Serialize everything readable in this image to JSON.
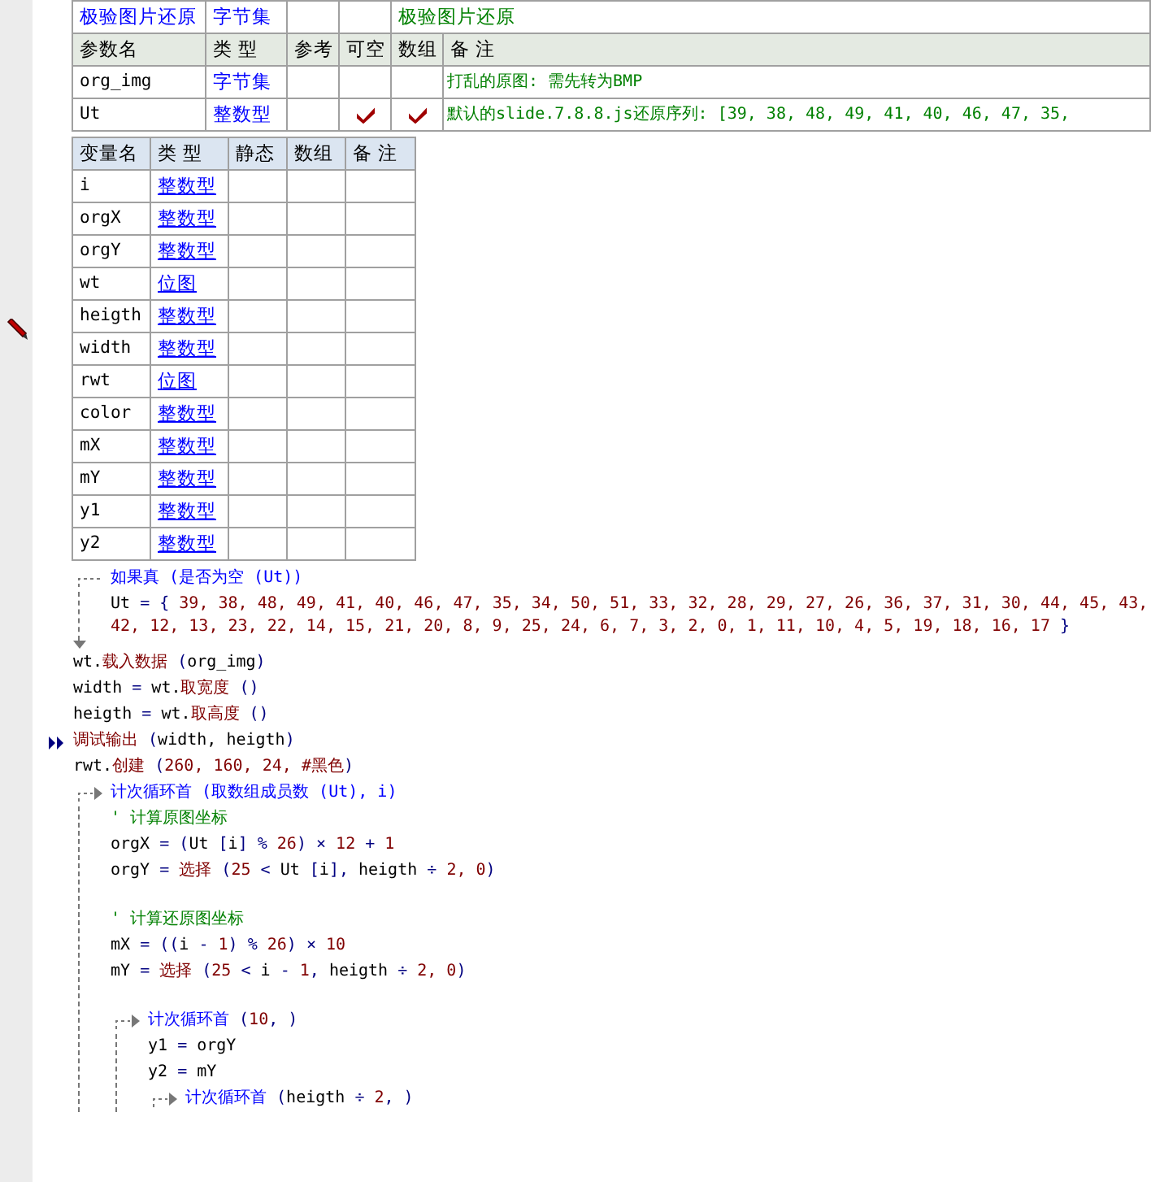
{
  "subroutine": {
    "name": "极验图片还原",
    "return_type": "字节集",
    "remark": "极验图片还原"
  },
  "params": {
    "columns": [
      "参数名",
      "类 型",
      "参考",
      "可空",
      "数组",
      "备 注"
    ],
    "rows": [
      {
        "name": "org_img",
        "type": "字节集",
        "ref": false,
        "nullable": false,
        "array": false,
        "remark": "打乱的原图: 需先转为BMP"
      },
      {
        "name": "Ut",
        "type": "整数型",
        "ref": false,
        "nullable": true,
        "array": true,
        "remark": "默认的slide.7.8.8.js还原序列: [39, 38, 48, 49, 41, 40, 46, 47, 35,"
      }
    ]
  },
  "variables": {
    "columns": [
      "变量名",
      "类 型",
      "静态",
      "数组",
      "备 注"
    ],
    "rows": [
      {
        "name": "i",
        "type": "整数型",
        "static": false,
        "array": false
      },
      {
        "name": "orgX",
        "type": "整数型",
        "static": false,
        "array": false
      },
      {
        "name": "orgY",
        "type": "整数型",
        "static": false,
        "array": false
      },
      {
        "name": "wt",
        "type": "位图",
        "static": false,
        "array": false
      },
      {
        "name": "heigth",
        "type": "整数型",
        "static": false,
        "array": false
      },
      {
        "name": "width",
        "type": "整数型",
        "static": false,
        "array": false
      },
      {
        "name": "rwt",
        "type": "位图",
        "static": false,
        "array": false
      },
      {
        "name": "color",
        "type": "整数型",
        "static": false,
        "array": false
      },
      {
        "name": "mX",
        "type": "整数型",
        "static": false,
        "array": false
      },
      {
        "name": "mY",
        "type": "整数型",
        "static": false,
        "array": false
      },
      {
        "name": "y1",
        "type": "整数型",
        "static": false,
        "array": false
      },
      {
        "name": "y2",
        "type": "整数型",
        "static": false,
        "array": false
      }
    ]
  },
  "code": [
    {
      "kind": "if",
      "head": [
        {
          "kind": "kw",
          "text": "如果真 (是否为空 (Ut))"
        }
      ],
      "children": [
        {
          "kind": "code",
          "segments": [
            {
              "kind": "var",
              "text": "Ut"
            },
            {
              "kind": "op",
              "text": " = { "
            },
            {
              "kind": "num",
              "text": "39, 38, 48, 49, 41, 40, 46, 47, 35, 34, 50, 51, 33, 32, 28, 29, 27, 26, 36, 37, 31, 30, 44, 45, 43, 42, 12, 13, 23, 22, 14, 15, 21, 20, 8, 9, 25, 24, 6, 7, 3, 2, 0, 1, 11, 10, 4, 5, 19, 18, 16, 17"
            },
            {
              "kind": "op",
              "text": " }"
            }
          ]
        }
      ]
    },
    {
      "kind": "code",
      "segments": [
        {
          "kind": "var",
          "text": "wt."
        },
        {
          "kind": "fn",
          "text": "载入数据"
        },
        {
          "kind": "op",
          "text": " ("
        },
        {
          "kind": "var",
          "text": "org_img"
        },
        {
          "kind": "op",
          "text": ")"
        }
      ]
    },
    {
      "kind": "code",
      "segments": [
        {
          "kind": "var",
          "text": "width"
        },
        {
          "kind": "op",
          "text": " = "
        },
        {
          "kind": "var",
          "text": "wt."
        },
        {
          "kind": "fn",
          "text": "取宽度"
        },
        {
          "kind": "op",
          "text": " ()"
        }
      ]
    },
    {
      "kind": "code",
      "segments": [
        {
          "kind": "var",
          "text": "heigth"
        },
        {
          "kind": "op",
          "text": " = "
        },
        {
          "kind": "var",
          "text": "wt."
        },
        {
          "kind": "fn",
          "text": "取高度"
        },
        {
          "kind": "op",
          "text": " ()"
        }
      ]
    },
    {
      "kind": "debug",
      "segments": [
        {
          "kind": "fn",
          "text": "调试输出"
        },
        {
          "kind": "op",
          "text": " ("
        },
        {
          "kind": "var",
          "text": "width, heigth"
        },
        {
          "kind": "op",
          "text": ")"
        }
      ]
    },
    {
      "kind": "code",
      "segments": [
        {
          "kind": "var",
          "text": "rwt."
        },
        {
          "kind": "fn",
          "text": "创建"
        },
        {
          "kind": "op",
          "text": " ("
        },
        {
          "kind": "num",
          "text": "260, 160, 24, "
        },
        {
          "kind": "fn",
          "text": "#黑色"
        },
        {
          "kind": "op",
          "text": ")"
        }
      ]
    },
    {
      "kind": "loop",
      "head": [
        {
          "kind": "kw",
          "text": "计次循环首 (取数组成员数 (Ut), i)"
        }
      ],
      "children": [
        {
          "kind": "comment",
          "text": "' 计算原图坐标"
        },
        {
          "kind": "code",
          "segments": [
            {
              "kind": "var",
              "text": "orgX"
            },
            {
              "kind": "op",
              "text": " = ("
            },
            {
              "kind": "var",
              "text": "Ut"
            },
            {
              "kind": "op",
              "text": " ["
            },
            {
              "kind": "var",
              "text": "i"
            },
            {
              "kind": "op",
              "text": "] % "
            },
            {
              "kind": "num",
              "text": "26"
            },
            {
              "kind": "op",
              "text": ") × "
            },
            {
              "kind": "num",
              "text": "12"
            },
            {
              "kind": "op",
              "text": " + "
            },
            {
              "kind": "num",
              "text": "1"
            }
          ]
        },
        {
          "kind": "code",
          "segments": [
            {
              "kind": "var",
              "text": "orgY"
            },
            {
              "kind": "op",
              "text": " = "
            },
            {
              "kind": "fn",
              "text": "选择"
            },
            {
              "kind": "op",
              "text": " ("
            },
            {
              "kind": "num",
              "text": "25"
            },
            {
              "kind": "op",
              "text": " < "
            },
            {
              "kind": "var",
              "text": "Ut"
            },
            {
              "kind": "op",
              "text": " ["
            },
            {
              "kind": "var",
              "text": "i"
            },
            {
              "kind": "op",
              "text": "], "
            },
            {
              "kind": "var",
              "text": "heigth"
            },
            {
              "kind": "op",
              "text": " ÷ "
            },
            {
              "kind": "num",
              "text": "2, 0"
            },
            {
              "kind": "op",
              "text": ")"
            }
          ]
        },
        {
          "kind": "blank"
        },
        {
          "kind": "comment",
          "text": "' 计算还原图坐标"
        },
        {
          "kind": "code",
          "segments": [
            {
              "kind": "var",
              "text": "mX"
            },
            {
              "kind": "op",
              "text": " = (("
            },
            {
              "kind": "var",
              "text": "i"
            },
            {
              "kind": "op",
              "text": " - "
            },
            {
              "kind": "num",
              "text": "1"
            },
            {
              "kind": "op",
              "text": ") % "
            },
            {
              "kind": "num",
              "text": "26"
            },
            {
              "kind": "op",
              "text": ") × "
            },
            {
              "kind": "num",
              "text": "10"
            }
          ]
        },
        {
          "kind": "code",
          "segments": [
            {
              "kind": "var",
              "text": "mY"
            },
            {
              "kind": "op",
              "text": " = "
            },
            {
              "kind": "fn",
              "text": "选择"
            },
            {
              "kind": "op",
              "text": " ("
            },
            {
              "kind": "num",
              "text": "25"
            },
            {
              "kind": "op",
              "text": " < "
            },
            {
              "kind": "var",
              "text": "i"
            },
            {
              "kind": "op",
              "text": " - "
            },
            {
              "kind": "num",
              "text": "1"
            },
            {
              "kind": "op",
              "text": ", "
            },
            {
              "kind": "var",
              "text": "heigth"
            },
            {
              "kind": "op",
              "text": " ÷ "
            },
            {
              "kind": "num",
              "text": "2, 0"
            },
            {
              "kind": "op",
              "text": ")"
            }
          ]
        },
        {
          "kind": "blank"
        },
        {
          "kind": "loop",
          "head": [
            {
              "kind": "kw",
              "text": "计次循环首"
            },
            {
              "kind": "op",
              "text": " ("
            },
            {
              "kind": "num",
              "text": "10"
            },
            {
              "kind": "op",
              "text": ", )"
            }
          ],
          "children": [
            {
              "kind": "code",
              "segments": [
                {
                  "kind": "var",
                  "text": "y1"
                },
                {
                  "kind": "op",
                  "text": " = "
                },
                {
                  "kind": "var",
                  "text": "orgY"
                }
              ]
            },
            {
              "kind": "code",
              "segments": [
                {
                  "kind": "var",
                  "text": "y2"
                },
                {
                  "kind": "op",
                  "text": " = "
                },
                {
                  "kind": "var",
                  "text": "mY"
                }
              ]
            },
            {
              "kind": "loop",
              "head": [
                {
                  "kind": "kw",
                  "text": "计次循环首"
                },
                {
                  "kind": "op",
                  "text": " ("
                },
                {
                  "kind": "var",
                  "text": "heigth"
                },
                {
                  "kind": "op",
                  "text": " ÷ "
                },
                {
                  "kind": "num",
                  "text": "2"
                },
                {
                  "kind": "op",
                  "text": ", )"
                }
              ]
            }
          ]
        }
      ]
    }
  ]
}
